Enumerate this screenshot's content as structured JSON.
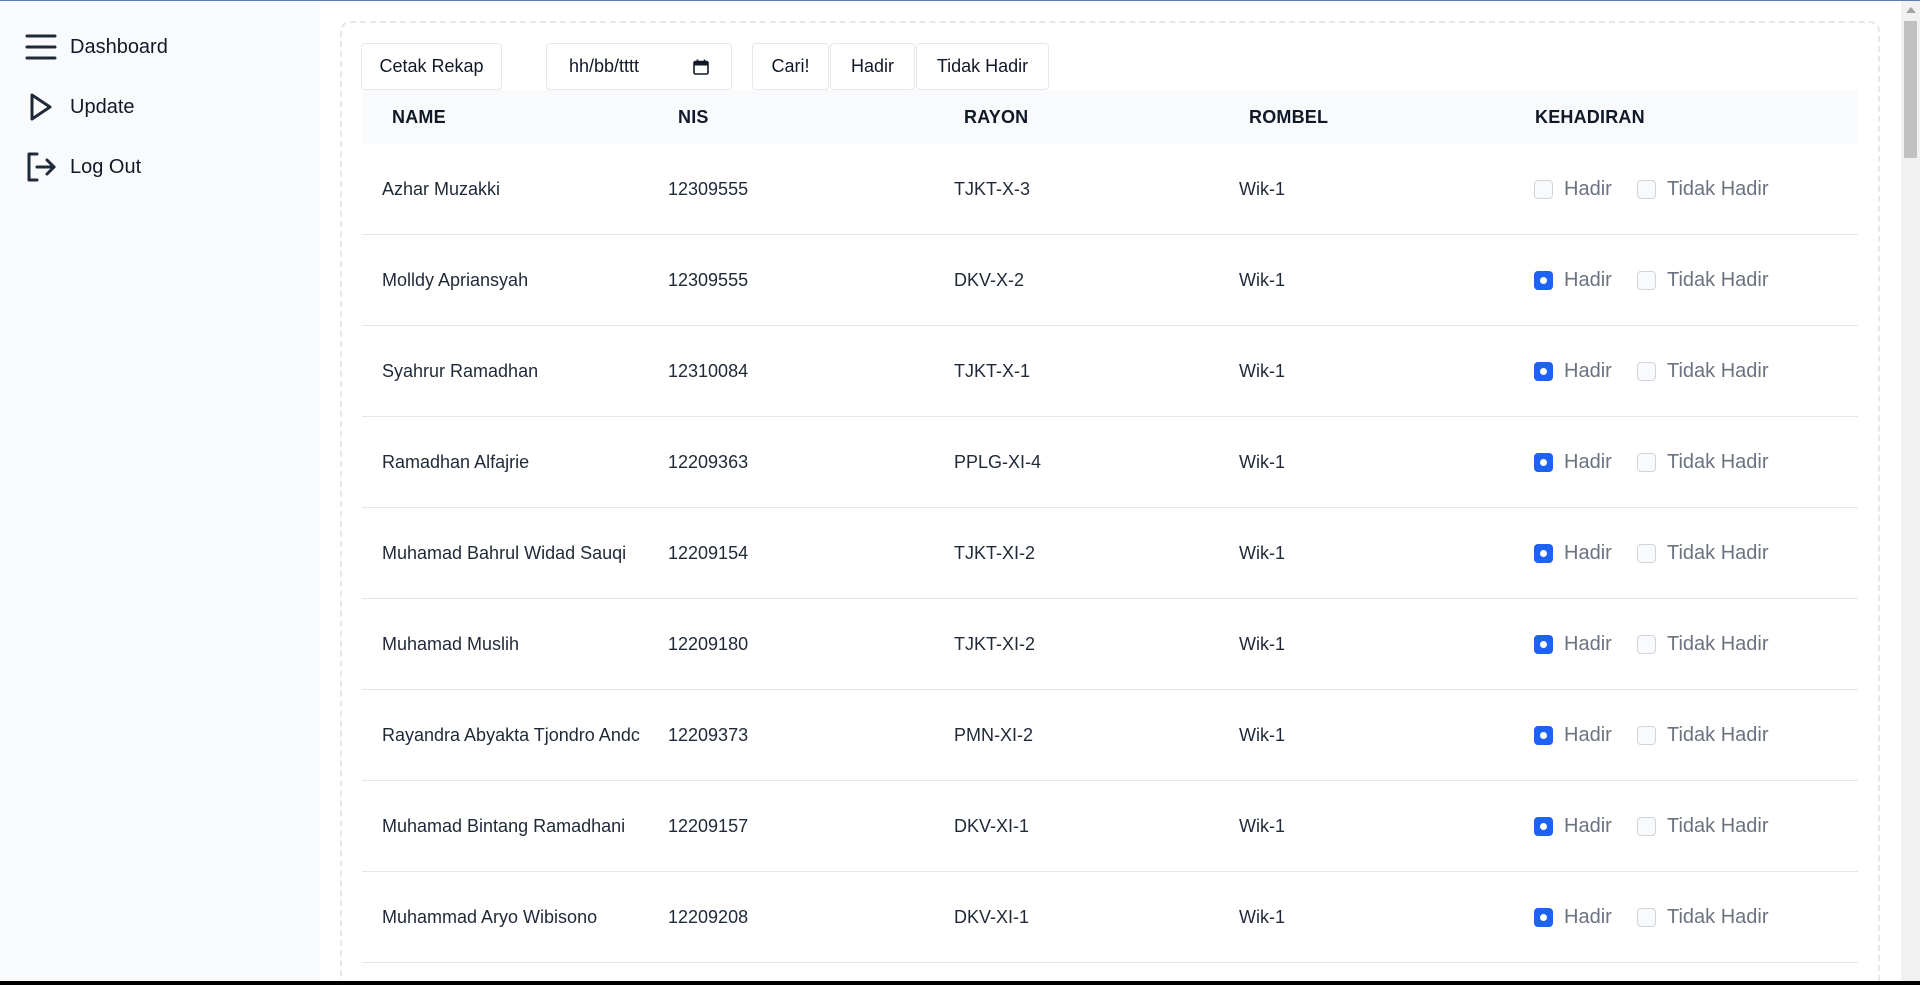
{
  "sidebar": {
    "items": [
      {
        "label": "Dashboard",
        "icon": "menu-icon"
      },
      {
        "label": "Update",
        "icon": "play-icon"
      },
      {
        "label": "Log Out",
        "icon": "logout-icon"
      }
    ]
  },
  "toolbar": {
    "print_label": "Cetak Rekap",
    "date_value": "hh/bb/tttt",
    "search_label": "Cari!",
    "present_label": "Hadir",
    "absent_label": "Tidak Hadir"
  },
  "table": {
    "headers": [
      "NAME",
      "NIS",
      "RAYON",
      "ROMBEL",
      "KEHADIRAN"
    ],
    "present_option": "Hadir",
    "absent_option": "Tidak Hadir",
    "rows": [
      {
        "name": "Azhar Muzakki",
        "nis": "12309555",
        "rayon": "TJKT-X-3",
        "rombel": "Wik-1",
        "hadir": false,
        "tidak_hadir": false
      },
      {
        "name": "Molldy Apriansyah",
        "nis": "12309555",
        "rayon": "DKV-X-2",
        "rombel": "Wik-1",
        "hadir": true,
        "tidak_hadir": false
      },
      {
        "name": "Syahrur Ramadhan",
        "nis": "12310084",
        "rayon": "TJKT-X-1",
        "rombel": "Wik-1",
        "hadir": true,
        "tidak_hadir": false
      },
      {
        "name": "Ramadhan Alfajrie",
        "nis": "12209363",
        "rayon": "PPLG-XI-4",
        "rombel": "Wik-1",
        "hadir": true,
        "tidak_hadir": false
      },
      {
        "name": "Muhamad Bahrul Widad Sauqi",
        "nis": "12209154",
        "rayon": "TJKT-XI-2",
        "rombel": "Wik-1",
        "hadir": true,
        "tidak_hadir": false
      },
      {
        "name": "Muhamad Muslih",
        "nis": "12209180",
        "rayon": "TJKT-XI-2",
        "rombel": "Wik-1",
        "hadir": true,
        "tidak_hadir": false
      },
      {
        "name": "Rayandra Abyakta Tjondro Andc",
        "nis": "12209373",
        "rayon": "PMN-XI-2",
        "rombel": "Wik-1",
        "hadir": true,
        "tidak_hadir": false
      },
      {
        "name": "Muhamad Bintang Ramadhani",
        "nis": "12209157",
        "rayon": "DKV-XI-1",
        "rombel": "Wik-1",
        "hadir": true,
        "tidak_hadir": false
      },
      {
        "name": "Muhammad Aryo Wibisono",
        "nis": "12209208",
        "rayon": "DKV-XI-1",
        "rombel": "Wik-1",
        "hadir": true,
        "tidak_hadir": false
      }
    ]
  },
  "colors": {
    "accent": "#1d62f0",
    "sidebar_bg": "#f9fafb",
    "header_bg": "#f9fafb"
  }
}
